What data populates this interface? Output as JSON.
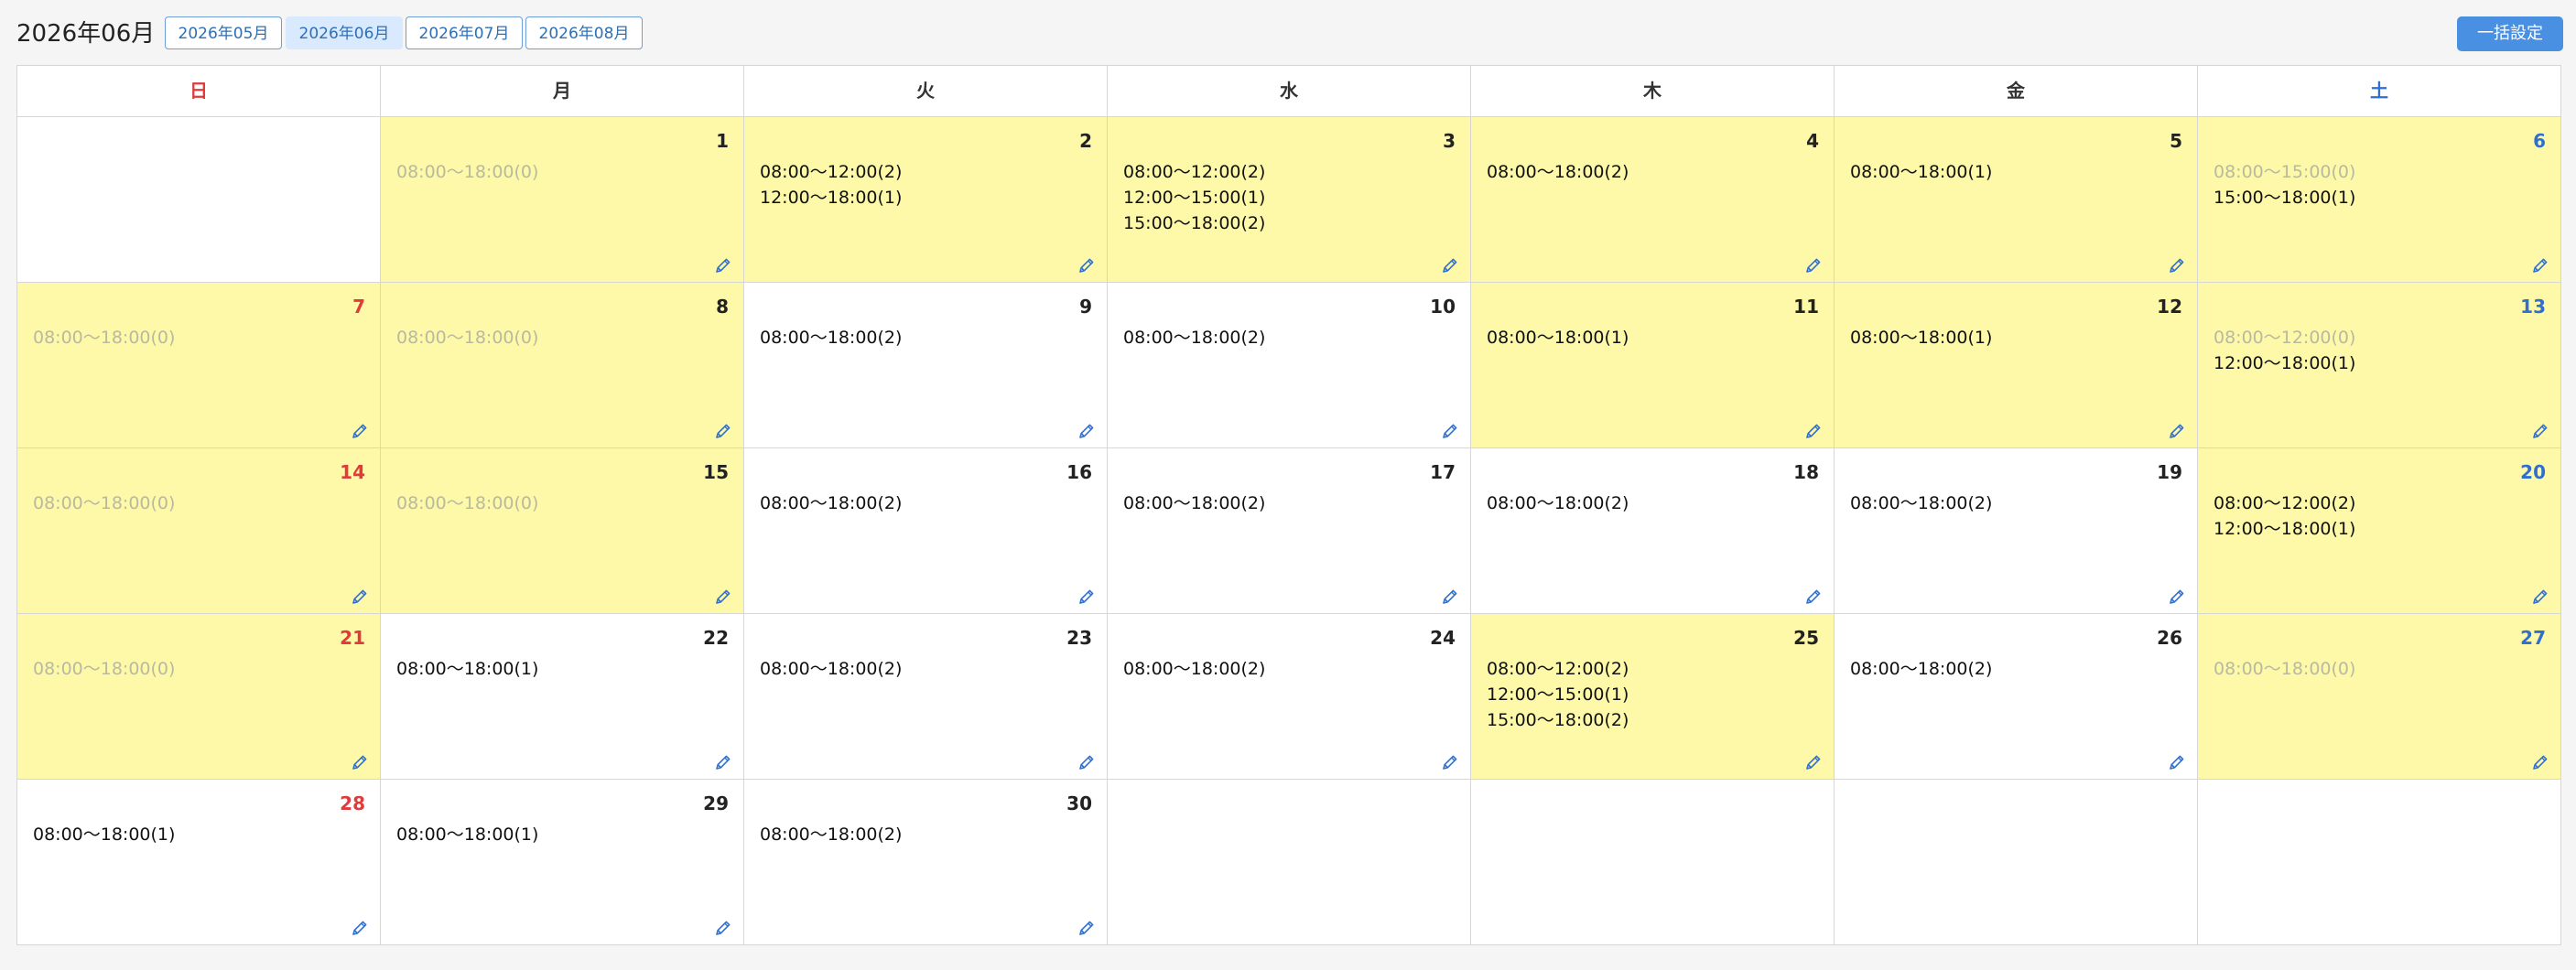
{
  "header": {
    "title": "2026年06月",
    "bulk_button": "一括設定"
  },
  "month_nav": [
    {
      "label": "2026年05月",
      "state": "focus"
    },
    {
      "label": "2026年06月",
      "state": "active"
    },
    {
      "label": "2026年07月",
      "state": "normal"
    },
    {
      "label": "2026年08月",
      "state": "normal"
    }
  ],
  "weekdays": [
    "日",
    "月",
    "火",
    "水",
    "木",
    "金",
    "土"
  ],
  "colors": {
    "highlight": "#fdf9a9",
    "sunday": "#e03a3a",
    "saturday": "#2f6fd0",
    "accent": "#4a90e2"
  },
  "icons": {
    "edit": "pencil-icon"
  },
  "weeks": [
    [
      null,
      {
        "day": "1",
        "hl": true,
        "slots": [
          {
            "text": "08:00〜18:00(0)",
            "zero": true
          }
        ]
      },
      {
        "day": "2",
        "hl": true,
        "slots": [
          {
            "text": "08:00〜12:00(2)",
            "zero": false
          },
          {
            "text": "12:00〜18:00(1)",
            "zero": false
          }
        ]
      },
      {
        "day": "3",
        "hl": true,
        "slots": [
          {
            "text": "08:00〜12:00(2)",
            "zero": false
          },
          {
            "text": "12:00〜15:00(1)",
            "zero": false
          },
          {
            "text": "15:00〜18:00(2)",
            "zero": false
          }
        ]
      },
      {
        "day": "4",
        "hl": true,
        "slots": [
          {
            "text": "08:00〜18:00(2)",
            "zero": false
          }
        ]
      },
      {
        "day": "5",
        "hl": true,
        "slots": [
          {
            "text": "08:00〜18:00(1)",
            "zero": false
          }
        ]
      },
      {
        "day": "6",
        "hl": true,
        "slots": [
          {
            "text": "08:00〜15:00(0)",
            "zero": true
          },
          {
            "text": "15:00〜18:00(1)",
            "zero": false
          }
        ]
      }
    ],
    [
      {
        "day": "7",
        "hl": true,
        "slots": [
          {
            "text": "08:00〜18:00(0)",
            "zero": true
          }
        ]
      },
      {
        "day": "8",
        "hl": true,
        "slots": [
          {
            "text": "08:00〜18:00(0)",
            "zero": true
          }
        ]
      },
      {
        "day": "9",
        "hl": false,
        "slots": [
          {
            "text": "08:00〜18:00(2)",
            "zero": false
          }
        ]
      },
      {
        "day": "10",
        "hl": false,
        "slots": [
          {
            "text": "08:00〜18:00(2)",
            "zero": false
          }
        ]
      },
      {
        "day": "11",
        "hl": true,
        "slots": [
          {
            "text": "08:00〜18:00(1)",
            "zero": false
          }
        ]
      },
      {
        "day": "12",
        "hl": true,
        "slots": [
          {
            "text": "08:00〜18:00(1)",
            "zero": false
          }
        ]
      },
      {
        "day": "13",
        "hl": true,
        "slots": [
          {
            "text": "08:00〜12:00(0)",
            "zero": true
          },
          {
            "text": "12:00〜18:00(1)",
            "zero": false
          }
        ]
      }
    ],
    [
      {
        "day": "14",
        "hl": true,
        "slots": [
          {
            "text": "08:00〜18:00(0)",
            "zero": true
          }
        ]
      },
      {
        "day": "15",
        "hl": true,
        "slots": [
          {
            "text": "08:00〜18:00(0)",
            "zero": true
          }
        ]
      },
      {
        "day": "16",
        "hl": false,
        "slots": [
          {
            "text": "08:00〜18:00(2)",
            "zero": false
          }
        ]
      },
      {
        "day": "17",
        "hl": false,
        "slots": [
          {
            "text": "08:00〜18:00(2)",
            "zero": false
          }
        ]
      },
      {
        "day": "18",
        "hl": false,
        "slots": [
          {
            "text": "08:00〜18:00(2)",
            "zero": false
          }
        ]
      },
      {
        "day": "19",
        "hl": false,
        "slots": [
          {
            "text": "08:00〜18:00(2)",
            "zero": false
          }
        ]
      },
      {
        "day": "20",
        "hl": true,
        "slots": [
          {
            "text": "08:00〜12:00(2)",
            "zero": false
          },
          {
            "text": "12:00〜18:00(1)",
            "zero": false
          }
        ]
      }
    ],
    [
      {
        "day": "21",
        "hl": true,
        "slots": [
          {
            "text": "08:00〜18:00(0)",
            "zero": true
          }
        ]
      },
      {
        "day": "22",
        "hl": false,
        "slots": [
          {
            "text": "08:00〜18:00(1)",
            "zero": false
          }
        ]
      },
      {
        "day": "23",
        "hl": false,
        "slots": [
          {
            "text": "08:00〜18:00(2)",
            "zero": false
          }
        ]
      },
      {
        "day": "24",
        "hl": false,
        "slots": [
          {
            "text": "08:00〜18:00(2)",
            "zero": false
          }
        ]
      },
      {
        "day": "25",
        "hl": true,
        "slots": [
          {
            "text": "08:00〜12:00(2)",
            "zero": false
          },
          {
            "text": "12:00〜15:00(1)",
            "zero": false
          },
          {
            "text": "15:00〜18:00(2)",
            "zero": false
          }
        ]
      },
      {
        "day": "26",
        "hl": false,
        "slots": [
          {
            "text": "08:00〜18:00(2)",
            "zero": false
          }
        ]
      },
      {
        "day": "27",
        "hl": true,
        "slots": [
          {
            "text": "08:00〜18:00(0)",
            "zero": true
          }
        ]
      }
    ],
    [
      {
        "day": "28",
        "hl": false,
        "slots": [
          {
            "text": "08:00〜18:00(1)",
            "zero": false
          }
        ]
      },
      {
        "day": "29",
        "hl": false,
        "slots": [
          {
            "text": "08:00〜18:00(1)",
            "zero": false
          }
        ]
      },
      {
        "day": "30",
        "hl": false,
        "slots": [
          {
            "text": "08:00〜18:00(2)",
            "zero": false
          }
        ]
      },
      null,
      null,
      null,
      null
    ]
  ]
}
